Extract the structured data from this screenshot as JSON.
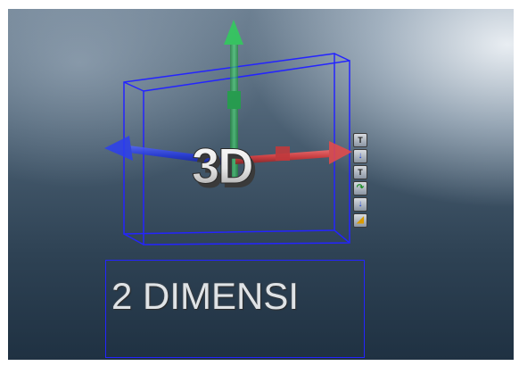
{
  "object_3d": {
    "text": "3D"
  },
  "object_2d": {
    "text": "2 DIMENSI"
  },
  "gizmo": {
    "x_axis_color": "#e03a3a",
    "y_axis_color": "#22c04a",
    "z_axis_color": "#2438e0",
    "selection_box_color": "#2424ff"
  },
  "toolbar": {
    "tools": [
      {
        "name": "translate-y-icon",
        "glyph": "T",
        "accent": "g"
      },
      {
        "name": "move-down-blue-icon",
        "glyph": "↓",
        "accent": "b"
      },
      {
        "name": "translate-x-icon",
        "glyph": "T",
        "accent": "y"
      },
      {
        "name": "rotate-green-icon",
        "glyph": "↷",
        "accent": "g"
      },
      {
        "name": "move-down-icon",
        "glyph": "↓",
        "accent": "b"
      },
      {
        "name": "scale-icon",
        "glyph": "◢",
        "accent": "y"
      }
    ]
  }
}
